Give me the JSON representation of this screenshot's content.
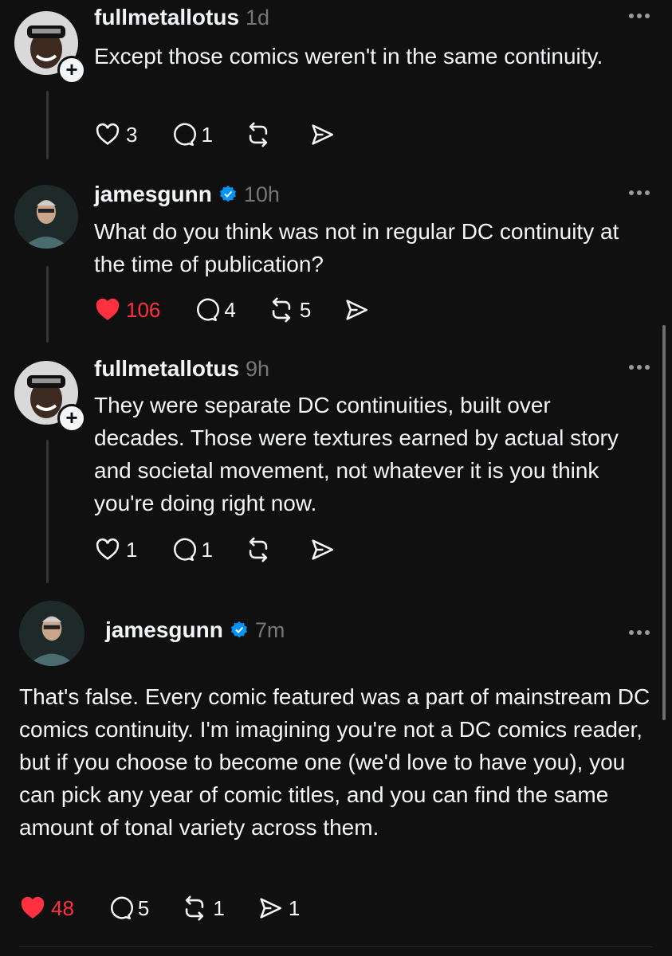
{
  "posts": [
    {
      "username": "fullmetallotus",
      "time": "1d",
      "text": "Except those comics weren't in the same continuity.",
      "likes": "3",
      "replies": "1",
      "reposts": "",
      "shares": "",
      "liked": false,
      "verified": false,
      "follow_badge": "+"
    },
    {
      "username": "jamesgunn",
      "time": "10h",
      "text": "What do you think was not in regular DC continuity at the time of publication?",
      "likes": "106",
      "replies": "4",
      "reposts": "5",
      "shares": "",
      "liked": true,
      "verified": true
    },
    {
      "username": "fullmetallotus",
      "time": "9h",
      "text": "They were separate DC continuities, built over decades. Those were textures earned by actual story and societal movement, not whatever it is you think you're doing right now.",
      "likes": "1",
      "replies": "1",
      "reposts": "",
      "shares": "",
      "liked": false,
      "verified": false,
      "follow_badge": "+"
    },
    {
      "username": "jamesgunn",
      "time": "7m",
      "text": "That's false. Every comic featured was a part of mainstream DC comics continuity. I'm imagining you're not a DC comics reader, but if you choose to become one (we'd love to have you), you can pick any year of comic titles, and you can find the same amount of tonal variety across them.",
      "likes": "48",
      "replies": "5",
      "reposts": "1",
      "shares": "1",
      "liked": true,
      "verified": true
    }
  ],
  "icons": {
    "like": "heart-icon",
    "reply": "comment-icon",
    "repost": "repost-icon",
    "share": "send-icon",
    "more": "more-options-icon",
    "verified": "verified-badge-icon"
  },
  "colors": {
    "background": "#101010",
    "text": "#f3f5f7",
    "muted": "#777777",
    "liked": "#ff3040",
    "verified": "#0095f6"
  }
}
